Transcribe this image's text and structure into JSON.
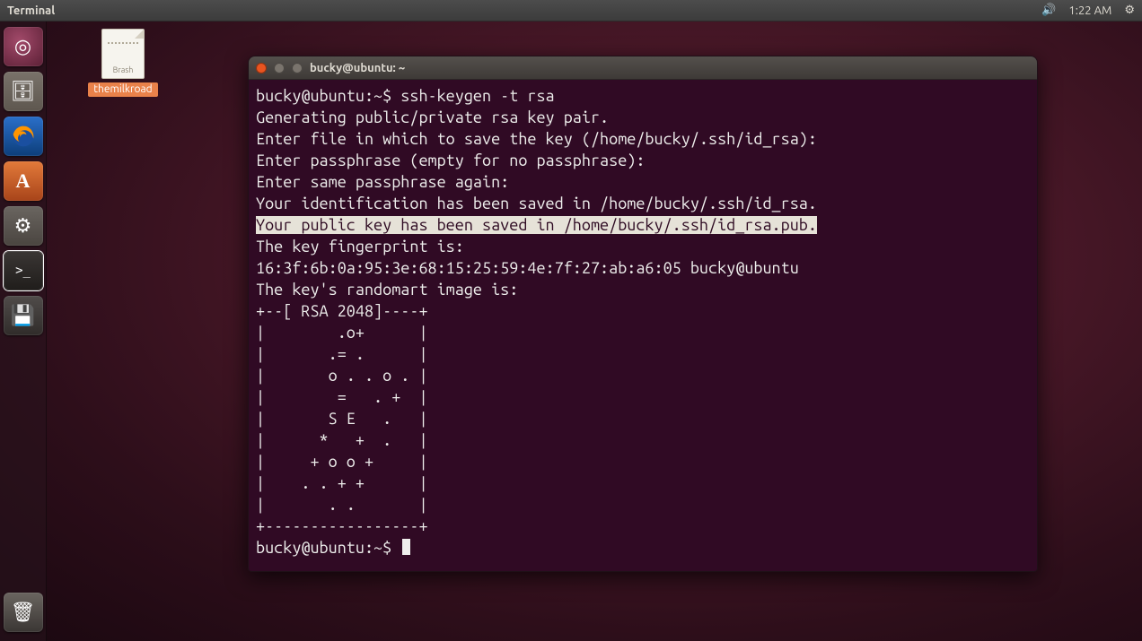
{
  "menubar": {
    "app_title": "Terminal",
    "clock": "1:22 AM"
  },
  "launcher": {
    "items": [
      {
        "name": "dash",
        "glyph": "◎"
      },
      {
        "name": "files",
        "glyph": "🗄"
      },
      {
        "name": "firefox",
        "glyph": ""
      },
      {
        "name": "software",
        "glyph": "A"
      },
      {
        "name": "settings",
        "glyph": "⚙"
      },
      {
        "name": "terminal",
        "glyph": ">_"
      },
      {
        "name": "save",
        "glyph": "💾"
      }
    ],
    "trash_glyph": "🗑"
  },
  "desktop": {
    "icon_label": "themilkroad",
    "doc_preview": "Brash"
  },
  "terminal": {
    "title": "bucky@ubuntu: ~",
    "prompt": "bucky@ubuntu:~$ ",
    "command": "ssh-keygen -t rsa",
    "lines": [
      "Generating public/private rsa key pair.",
      "Enter file in which to save the key (/home/bucky/.ssh/id_rsa):",
      "Enter passphrase (empty for no passphrase):",
      "Enter same passphrase again:",
      "Your identification has been saved in /home/bucky/.ssh/id_rsa."
    ],
    "selected_line": "Your public key has been saved in /home/bucky/.ssh/id_rsa.pub.",
    "lines2": [
      "The key fingerprint is:",
      "16:3f:6b:0a:95:3e:68:15:25:59:4e:7f:27:ab:a6:05 bucky@ubuntu",
      "The key's randomart image is:",
      "+--[ RSA 2048]----+",
      "|        .o+      |",
      "|       .= .      |",
      "|       o . . o . |",
      "|        =   . +  |",
      "|       S E   .   |",
      "|      *   +  .   |",
      "|     + o o +     |",
      "|    . . + +      |",
      "|       . .       |",
      "+-----------------+"
    ],
    "final_prompt": "bucky@ubuntu:~$ "
  }
}
